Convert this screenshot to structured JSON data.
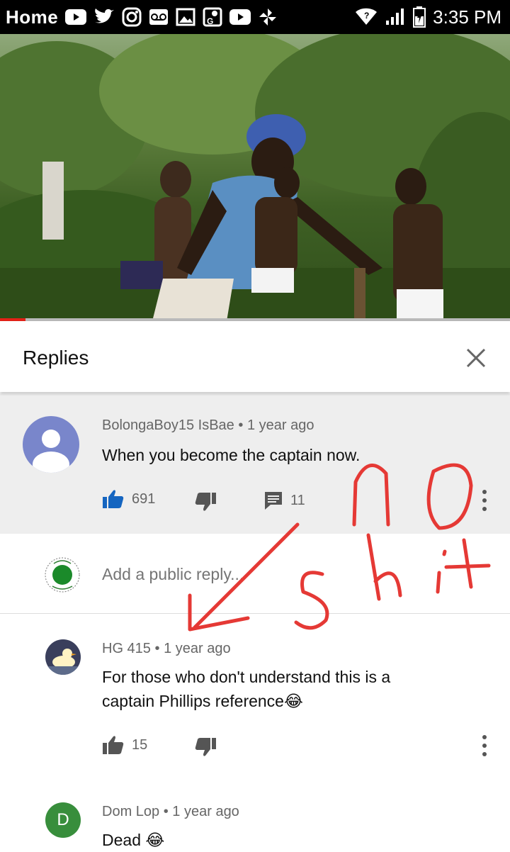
{
  "status_bar": {
    "home_label": "Home",
    "time": "3:35 PM",
    "icons": [
      "youtube-icon",
      "twitter-icon",
      "instagram-icon",
      "voicemail-icon",
      "gallery-icon",
      "maps-icon",
      "youtube-icon",
      "pinwheel-icon",
      "wifi-icon",
      "signal-icon",
      "battery-icon"
    ]
  },
  "video": {
    "progress_fraction": 0.05
  },
  "replies_panel": {
    "title": "Replies",
    "close_icon": "close-icon"
  },
  "parent_comment": {
    "author": "BolongaBoy15 IsBae",
    "separator": "•",
    "time": "1 year ago",
    "text": "When you become the captain now.",
    "likes": "691",
    "reply_count": "11"
  },
  "reply_box": {
    "placeholder": "Add a public reply..."
  },
  "replies": [
    {
      "author": "HG 415",
      "separator": "•",
      "time": "1 year ago",
      "text_line1": "For those who don't understand this is a",
      "text_line2": "captain Phillips reference😂",
      "likes": "15"
    },
    {
      "avatar_letter": "D",
      "author": "Dom Lop",
      "separator": "•",
      "time": "1 year ago",
      "text": "Dead 😂"
    }
  ],
  "colors": {
    "accent_blue": "#1565c0",
    "progress_red": "#e62117",
    "scribble_red": "#e53935"
  }
}
